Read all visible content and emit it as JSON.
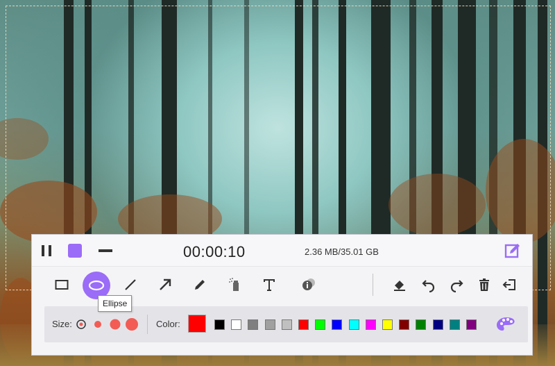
{
  "toolbar": {
    "timer": "00:00:10",
    "storage": "2.36 MB/35.01 GB"
  },
  "tools": {
    "active": "ellipse",
    "tooltip": "Ellipse"
  },
  "options": {
    "size_label": "Size:",
    "color_label": "Color:",
    "selected_color": "#FF0000",
    "palette": [
      "#000000",
      "#FFFFFF",
      "#808080",
      "#A0A0A0",
      "#C0C0C0",
      "#FF0000",
      "#00FF00",
      "#0000FF",
      "#00FFFF",
      "#FF00FF",
      "#FFFF00",
      "#800000",
      "#008000",
      "#000080",
      "#008080",
      "#800080"
    ]
  },
  "colors": {
    "accent": "#9B6CF7",
    "size_dot": "#F25C54"
  }
}
